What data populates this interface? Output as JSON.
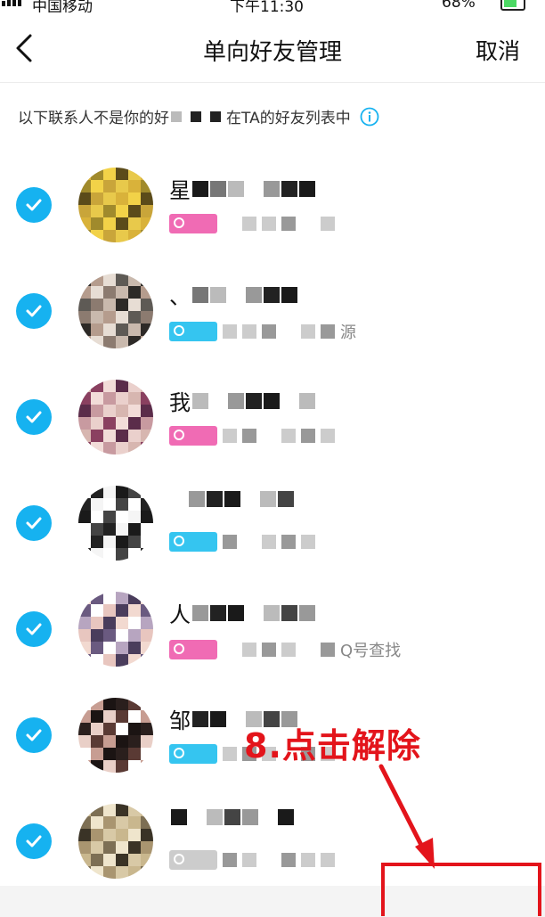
{
  "status_bar": {
    "carrier": "中国移动",
    "time": "下午11:30",
    "battery": "68%"
  },
  "nav": {
    "title": "单向好友管理",
    "cancel_label": "取消"
  },
  "notice": {
    "text_before": "以下联系人不是你的好",
    "text_after": "在TA的好友列表中"
  },
  "contacts": [
    {
      "name_prefix": "星",
      "checked": true,
      "badge_color": "#f06bb4",
      "sub_text": ""
    },
    {
      "name_prefix": "、",
      "checked": true,
      "badge_color": "#35c5f0",
      "sub_text": "源"
    },
    {
      "name_prefix": "我",
      "checked": true,
      "badge_color": "#f06bb4",
      "sub_text": ""
    },
    {
      "name_prefix": "",
      "checked": true,
      "badge_color": "#35c5f0",
      "sub_text": ""
    },
    {
      "name_prefix": "人",
      "checked": true,
      "badge_color": "#f06bb4",
      "sub_text": "Q号查找"
    },
    {
      "name_prefix": "邹",
      "checked": true,
      "badge_color": "#35c5f0",
      "sub_text": ""
    },
    {
      "name_prefix": "",
      "checked": true,
      "badge_color": "#cccccc",
      "sub_text": ""
    }
  ],
  "annotation": {
    "text": "8.点击解除",
    "color": "#e3141b"
  },
  "colors": {
    "accent": "#16b2f0",
    "annotation_red": "#e3141b"
  }
}
